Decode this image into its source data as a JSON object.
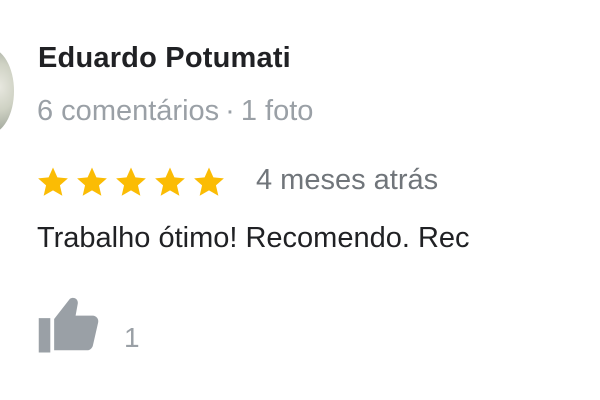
{
  "review": {
    "reviewer_name": "Eduardo Potumati",
    "reviews_count": "6 comentários",
    "separator": "·",
    "photos_count": "1 foto",
    "rating": 5,
    "rating_max": 5,
    "time_ago": "4 meses atrás",
    "text": "Trabalho ótimo! Recomendo. Rec",
    "likes": "1"
  },
  "colors": {
    "star": "#fbbc04",
    "name": "#202124",
    "meta": "#9aa0a6",
    "thumb": "#9aa0a6"
  },
  "icons": {
    "star": "star-icon",
    "like": "thumbs-up-icon"
  }
}
